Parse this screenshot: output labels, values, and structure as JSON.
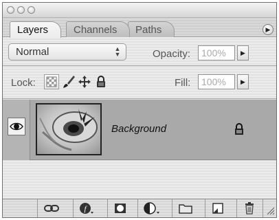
{
  "tabs": [
    {
      "label": "Layers",
      "active": true
    },
    {
      "label": "Channels",
      "active": false
    },
    {
      "label": "Paths",
      "active": false
    }
  ],
  "blend": {
    "mode": "Normal",
    "opacity_label": "Opacity:",
    "opacity_value": "100%"
  },
  "lock": {
    "label": "Lock:",
    "fill_label": "Fill:",
    "fill_value": "100%"
  },
  "layers": [
    {
      "name": "Background",
      "visible": true,
      "locked": true
    }
  ],
  "toolbar_icons": [
    "link-icon",
    "layer-style-icon",
    "mask-icon",
    "adjustment-icon",
    "group-folder-icon",
    "new-layer-icon",
    "trash-icon"
  ]
}
